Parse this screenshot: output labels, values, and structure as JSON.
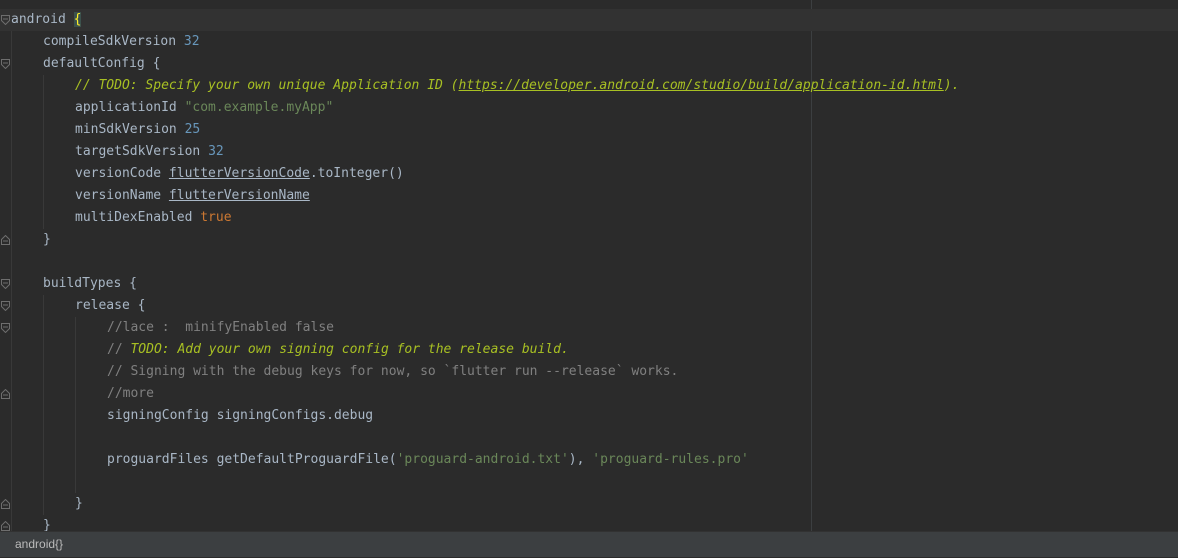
{
  "editor": {
    "lines": [
      {
        "indent": 0,
        "current": true,
        "fold": "open",
        "tokens": [
          {
            "t": "android "
          },
          {
            "t": "{",
            "c": "brace-hl"
          }
        ]
      },
      {
        "indent": 1,
        "tokens": [
          {
            "t": "compileSdkVersion "
          },
          {
            "t": "32",
            "c": "num"
          }
        ]
      },
      {
        "indent": 1,
        "fold": "open",
        "tokens": [
          {
            "t": "defaultConfig {"
          }
        ]
      },
      {
        "indent": 2,
        "tokens": [
          {
            "t": "// ",
            "c": "todo"
          },
          {
            "t": "TODO: Specify your own unique Application ID (",
            "c": "todo"
          },
          {
            "t": "https://developer.android.com/studio/build/application-id.html",
            "c": "todo u"
          },
          {
            "t": ").",
            "c": "todo"
          }
        ]
      },
      {
        "indent": 2,
        "tokens": [
          {
            "t": "applicationId "
          },
          {
            "t": "\"com.example.myApp\"",
            "c": "str"
          }
        ]
      },
      {
        "indent": 2,
        "tokens": [
          {
            "t": "minSdkVersion "
          },
          {
            "t": "25",
            "c": "num"
          }
        ]
      },
      {
        "indent": 2,
        "tokens": [
          {
            "t": "targetSdkVersion "
          },
          {
            "t": "32",
            "c": "num"
          }
        ]
      },
      {
        "indent": 2,
        "tokens": [
          {
            "t": "versionCode "
          },
          {
            "t": "flutterVersionCode",
            "c": "u"
          },
          {
            "t": ".toInteger()"
          }
        ]
      },
      {
        "indent": 2,
        "tokens": [
          {
            "t": "versionName "
          },
          {
            "t": "flutterVersionName",
            "c": "u"
          }
        ]
      },
      {
        "indent": 2,
        "tokens": [
          {
            "t": "multiDexEnabled "
          },
          {
            "t": "true",
            "c": "kw"
          }
        ]
      },
      {
        "indent": 1,
        "fold": "close",
        "tokens": [
          {
            "t": "}"
          }
        ]
      },
      {
        "indent": 0,
        "tokens": []
      },
      {
        "indent": 1,
        "fold": "open",
        "tokens": [
          {
            "t": "buildTypes {"
          }
        ]
      },
      {
        "indent": 2,
        "fold": "open",
        "tokens": [
          {
            "t": "release {"
          }
        ]
      },
      {
        "indent": 3,
        "fold": "open",
        "tokens": [
          {
            "t": "//lace :  minifyEnabled false",
            "c": "cmt"
          }
        ]
      },
      {
        "indent": 3,
        "tokens": [
          {
            "t": "// ",
            "c": "cmt"
          },
          {
            "t": "TODO: Add your own signing config for the release build.",
            "c": "todo"
          }
        ]
      },
      {
        "indent": 3,
        "tokens": [
          {
            "t": "// Signing with the debug keys for now, so `flutter run --release` works.",
            "c": "cmt"
          }
        ]
      },
      {
        "indent": 3,
        "fold": "close",
        "tokens": [
          {
            "t": "//more",
            "c": "cmt"
          }
        ]
      },
      {
        "indent": 3,
        "tokens": [
          {
            "t": "signingConfig signingConfigs.debug"
          }
        ]
      },
      {
        "indent": 0,
        "tokens": []
      },
      {
        "indent": 3,
        "tokens": [
          {
            "t": "proguardFiles getDefaultProguardFile("
          },
          {
            "t": "'proguard-android.txt'",
            "c": "str"
          },
          {
            "t": "), "
          },
          {
            "t": "'proguard-rules.pro'",
            "c": "str"
          }
        ]
      },
      {
        "indent": 0,
        "tokens": []
      },
      {
        "indent": 2,
        "fold": "close",
        "tokens": [
          {
            "t": "}"
          }
        ]
      },
      {
        "indent": 1,
        "fold": "close",
        "tokens": [
          {
            "t": "}"
          }
        ]
      }
    ]
  },
  "statusbar": {
    "breadcrumb": "android{}"
  },
  "colors": {
    "background": "#2b2b2b",
    "number": "#6897bb",
    "string": "#6a8759",
    "keyword": "#cc7832",
    "comment": "#808080",
    "todo": "#a8c023",
    "default": "#a9b7c6"
  }
}
